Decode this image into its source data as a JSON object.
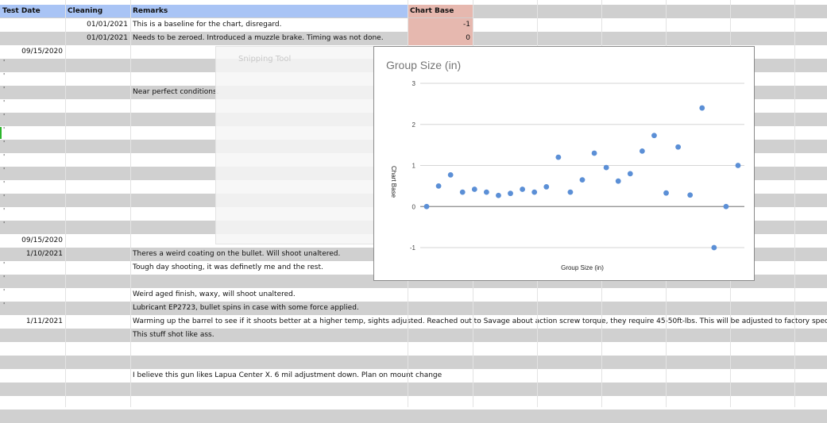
{
  "sheet": {
    "headers": {
      "test_date": "Test Date",
      "cleaning": "Cleaning",
      "remarks": "Remarks",
      "chart_base": "Chart Base"
    },
    "rows": [
      {
        "gray": false,
        "date": "",
        "cleaning": "01/01/2021",
        "remarks": "This is a baseline for the chart, disregard.",
        "chart_base": "-1",
        "tick": ""
      },
      {
        "gray": true,
        "date": "",
        "cleaning": "01/01/2021",
        "remarks": "Needs to be zeroed. Introduced a muzzle brake. Timing was not done.",
        "chart_base": "0",
        "tick": ""
      },
      {
        "gray": false,
        "date": "09/15/2020",
        "cleaning": "",
        "remarks": "",
        "chart_base": "",
        "tick": ""
      },
      {
        "gray": true,
        "date": "",
        "cleaning": "",
        "remarks": "",
        "chart_base": "",
        "tick": "'"
      },
      {
        "gray": false,
        "date": "",
        "cleaning": "",
        "remarks": "",
        "chart_base": "",
        "tick": "'"
      },
      {
        "gray": true,
        "date": "",
        "cleaning": "",
        "remarks": "Near perfect conditions.",
        "chart_base": "",
        "tick": "'"
      },
      {
        "gray": false,
        "date": "",
        "cleaning": "",
        "remarks": "",
        "chart_base": "",
        "tick": "'"
      },
      {
        "gray": true,
        "date": "",
        "cleaning": "",
        "remarks": "",
        "chart_base": "",
        "tick": "'"
      },
      {
        "gray": false,
        "date": "",
        "cleaning": "",
        "remarks": "",
        "chart_base": "",
        "tick": "'"
      },
      {
        "gray": true,
        "date": "",
        "cleaning": "",
        "remarks": "",
        "chart_base": "",
        "tick": "'"
      },
      {
        "gray": false,
        "date": "",
        "cleaning": "",
        "remarks": "",
        "chart_base": "",
        "tick": "'"
      },
      {
        "gray": true,
        "date": "",
        "cleaning": "",
        "remarks": "",
        "chart_base": "",
        "tick": "'"
      },
      {
        "gray": false,
        "date": "",
        "cleaning": "",
        "remarks": "",
        "chart_base": "",
        "tick": "'"
      },
      {
        "gray": true,
        "date": "",
        "cleaning": "",
        "remarks": "",
        "chart_base": "",
        "tick": "'"
      },
      {
        "gray": false,
        "date": "",
        "cleaning": "",
        "remarks": "",
        "chart_base": "",
        "tick": "'"
      },
      {
        "gray": true,
        "date": "",
        "cleaning": "",
        "remarks": "",
        "chart_base": "",
        "tick": "'"
      },
      {
        "gray": false,
        "date": "09/15/2020",
        "cleaning": "",
        "remarks": "",
        "chart_base": "",
        "tick": ""
      },
      {
        "gray": true,
        "date": "1/10/2021",
        "cleaning": "",
        "remarks": "Theres a weird coating on the bullet. Will shoot unaltered.",
        "chart_base": "",
        "tick": ""
      },
      {
        "gray": false,
        "date": "",
        "cleaning": "",
        "remarks": "Tough day shooting, it was definetly me and the rest.",
        "chart_base": "",
        "tick": "'"
      },
      {
        "gray": true,
        "date": "",
        "cleaning": "",
        "remarks": "",
        "chart_base": "",
        "tick": "'"
      },
      {
        "gray": false,
        "date": "",
        "cleaning": "",
        "remarks": "Weird aged finish, waxy, will shoot unaltered.",
        "chart_base": "",
        "tick": "'"
      },
      {
        "gray": true,
        "date": "",
        "cleaning": "",
        "remarks": "Lubricant EP2723, bullet spins in case with some force applied.",
        "chart_base": "",
        "tick": "'"
      },
      {
        "gray": false,
        "date": "1/11/2021",
        "cleaning": "",
        "remarks": "Warming up the barrel to see if it shoots better at a higher temp, sights adjusted. Reached out to Savage about action screw torque, they require 45-50ft-lbs. This will be adjusted to factory spec.",
        "chart_base": "",
        "tick": ""
      },
      {
        "gray": true,
        "date": "",
        "cleaning": "",
        "remarks": "This stuff shot like ass.",
        "chart_base": "",
        "tick": ""
      },
      {
        "gray": false,
        "date": "",
        "cleaning": "",
        "remarks": "",
        "chart_base": "",
        "tick": ""
      },
      {
        "gray": true,
        "date": "",
        "cleaning": "",
        "remarks": "",
        "chart_base": "",
        "tick": ""
      },
      {
        "gray": false,
        "date": "",
        "cleaning": "",
        "remarks": "I believe this gun likes Lapua Center X. 6 mil adjustment down. Plan on mount change",
        "chart_base": "",
        "tick": ""
      },
      {
        "gray": true,
        "date": "",
        "cleaning": "",
        "remarks": "",
        "chart_base": "",
        "tick": ""
      },
      {
        "gray": false,
        "date": "",
        "cleaning": "",
        "remarks": "",
        "chart_base": "",
        "tick": ""
      },
      {
        "gray": true,
        "date": "",
        "cleaning": "",
        "remarks": "",
        "chart_base": "",
        "tick": ""
      }
    ]
  },
  "ghost_window": {
    "title": "Snipping Tool"
  },
  "chart_data": {
    "type": "scatter",
    "title": "Group Size (in)",
    "xlabel": "Group Size (in)",
    "ylabel": "Chart Base",
    "ylim": [
      -1,
      3
    ],
    "yticks": [
      3,
      2,
      1,
      0,
      -1
    ],
    "grid": true,
    "color": "#5b8fd6",
    "x": [
      1,
      2,
      3,
      4,
      5,
      6,
      7,
      8,
      9,
      10,
      11,
      12,
      13,
      14,
      15,
      16,
      17,
      18,
      19,
      20,
      21,
      22,
      23,
      24,
      25,
      26,
      27
    ],
    "y": [
      0,
      0.5,
      0.77,
      0.35,
      0.42,
      0.35,
      0.27,
      0.32,
      0.42,
      0.35,
      0.48,
      1.2,
      0.35,
      0.65,
      1.3,
      0.95,
      0.62,
      0.8,
      1.35,
      1.73,
      0.33,
      1.45,
      0.28,
      2.4,
      -1.0,
      0,
      1.0
    ]
  }
}
